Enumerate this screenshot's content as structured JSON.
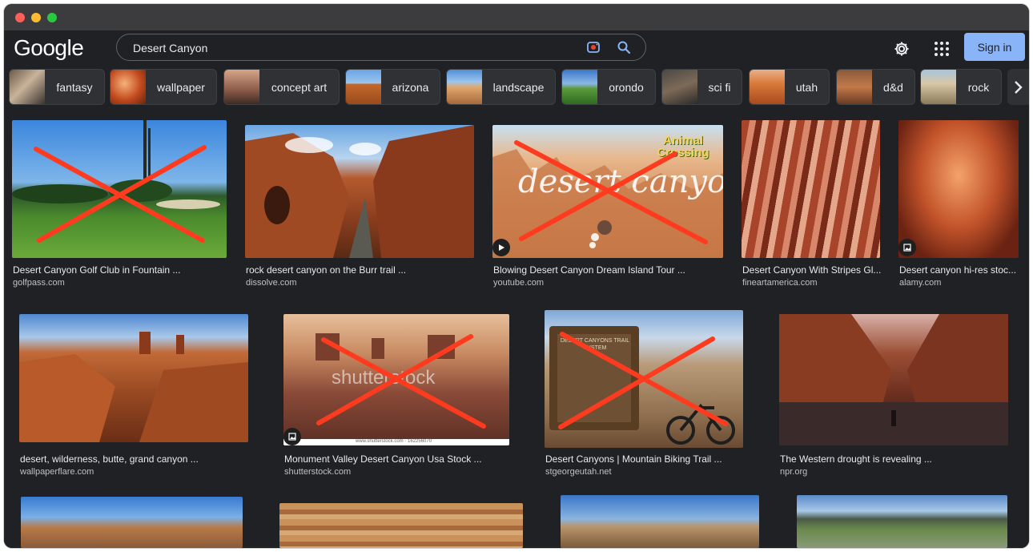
{
  "app": {
    "logo": "Google"
  },
  "search": {
    "query": "Desert Canyon"
  },
  "header": {
    "sign_in_label": "Sign in"
  },
  "chips": [
    "fantasy",
    "wallpaper",
    "concept art",
    "arizona",
    "landscape",
    "orondo",
    "sci fi",
    "utah",
    "d&d",
    "rock"
  ],
  "results": [
    {
      "title": "Desert Canyon Golf Club in Fountain ...",
      "source": "golfpass.com"
    },
    {
      "title": "rock desert canyon on the Burr trail ...",
      "source": "dissolve.com"
    },
    {
      "title": "Blowing Desert Canyon Dream Island Tour ...",
      "source": "youtube.com",
      "overlay_text": "desert canyon",
      "badge_text": "Animal Crossing"
    },
    {
      "title": "Desert Canyon With Stripes Gl...",
      "source": "fineartamerica.com"
    },
    {
      "title": "Desert canyon hi-res stoc...",
      "source": "alamy.com"
    },
    {
      "title": "desert, wilderness, butte, grand canyon ...",
      "source": "wallpaperflare.com"
    },
    {
      "title": "Monument Valley Desert Canyon Usa Stock ...",
      "source": "shutterstock.com",
      "watermark": "shutterstock",
      "caption": "www.shutterstock.com · 162256070"
    },
    {
      "title": "Desert Canyons | Mountain Biking Trail ...",
      "source": "stgeorgeutah.net",
      "sign_text": "DESERT CANYONS TRAIL SYSTEM"
    },
    {
      "title": "The Western drought is revealing ...",
      "source": "npr.org"
    }
  ],
  "colors": {
    "background": "#202124",
    "titlebar": "#3c3c3e",
    "accent": "#8ab4f8",
    "cross_mark": "#ff3b1f",
    "text": "#e8eaed",
    "subtext": "#bdc1c6"
  },
  "icons": [
    "lens-icon",
    "search-icon",
    "gear-icon",
    "apps-icon",
    "play-icon",
    "image-badge-icon",
    "chevron-right-icon"
  ]
}
